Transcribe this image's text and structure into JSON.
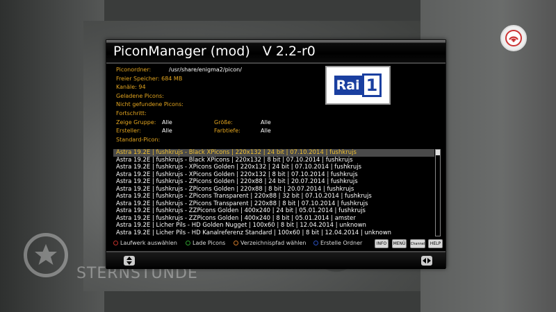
{
  "window": {
    "title": "PiconManager (mod)   V 2.2-r0"
  },
  "info": {
    "piconordner_label": "Piconordner:",
    "piconordner_value": "/usr/share/enigma2/picon/",
    "freier_speicher_label": "Freier Speicher: 684 MB",
    "kanaele_label": "Kanäle: 94",
    "geladene_picons_label": "Geladene Picons:",
    "nicht_gefunden_label": "Nicht gefundene Picons:",
    "fortschritt_label": "Fortschritt:",
    "zeige_gruppe_label": "Zeige Gruppe:",
    "zeige_gruppe_value": "Alle",
    "groesse_label": "Größe:",
    "groesse_value": "Alle",
    "ersteller_label": "Ersteller:",
    "ersteller_value": "Alle",
    "farbtiefe_label": "Farbtiefe:",
    "farbtiefe_value": "Alle",
    "standard_picon_label": "Standard-Picon:"
  },
  "picon_preview": {
    "text": "Rai",
    "number": "1"
  },
  "list": {
    "selected_index": 0,
    "items": [
      "Astra 19.2E | fushkrujs - Black XPicons | 220x132 | 24 bit | 07.10.2014 | fushkrujs",
      "Astra 19.2E | fushkrujs - Black XPicons | 220x132 | 8 bit | 07.10.2014 | fushkrujs",
      "Astra 19.2E | fushkrujs - XPicons Golden | 220x132 | 24 bit | 07.10.2014 | fushkrujs",
      "Astra 19.2E | fushkrujs - XPicons Golden | 220x132 | 8 bit | 07.10.2014 | fushkrujs",
      "Astra 19.2E | fushkrujs - ZPicons Golden | 220x88 | 24 bit | 20.07.2014 | fushkrujs",
      "Astra 19.2E | fushkrujs - ZPicons Golden | 220x88 | 8 bit | 20.07.2014 | fushkrujs",
      "Astra 19.2E | fushkrujs - ZPicons Transparent | 220x88 | 32 bit | 07.10.2014 | fushkrujs",
      "Astra 19.2E | fushkrujs - ZPicons Transparent | 220x88 | 8 bit | 07.10.2014 | fushkrujs",
      "Astra 19.2E | fushkrujs - ZZPicons Golden | 400x240 | 24 bit | 05.01.2014 | fushkrujs",
      "Astra 19.2E | fushkrujs - ZZPicons Golden | 400x240 | 8 bit | 05.01.2014 | amster",
      "Astra 19.2E | Licher Pils - HD Golden Nugget | 100x60 | 8 bit | 12.04.2014 | unknown",
      "Astra 19.2E | Licher Pils - HD Kanalreferenz Standard | 100x60 | 8 bit | 12.04.2014 | unknown"
    ]
  },
  "color_buttons": {
    "red_label": "Laufwerk auswählen",
    "green_label": "Lade Picons",
    "yellow_label": "Verzeichnispfad wählen",
    "blue_label": "Erstelle Ordner",
    "red_color": "#c0302a",
    "green_color": "#2fa02f",
    "yellow_color": "#d07a2a",
    "blue_color": "#2a4fc0"
  },
  "keys": {
    "info": "INFO",
    "menu": "MENÜ",
    "channel": "Channel",
    "help": "HELP"
  },
  "watermark": {
    "text": "STERNSTUNDE"
  },
  "colors": {
    "label": "#e3a51f",
    "selected_text": "#f0c030",
    "picon_red": "#e0231c",
    "picon_blue": "#1a3fa0"
  }
}
